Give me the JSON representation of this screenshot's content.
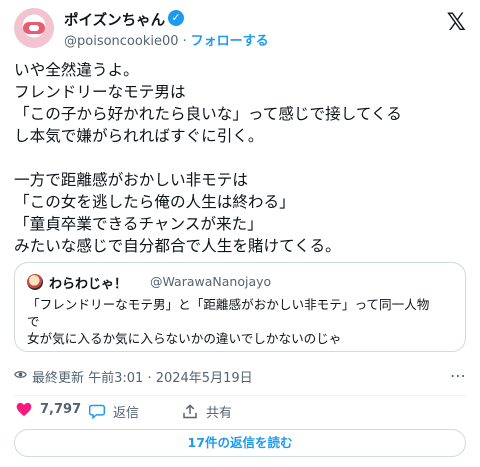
{
  "author": {
    "name": "ポイズンちゃん",
    "handle": "@poisoncookie00",
    "separator": "·",
    "follow_label": "フォローする",
    "verified_mark": "✓"
  },
  "x_logo": "𝕏",
  "post_lines": [
    "いや全然違うよ。",
    "フレンドリーなモテ男は",
    "「この子から好かれたら良いな」って感じで接してくる",
    "し本気で嫌がられればすぐに引く。",
    "",
    "一方で距離感がおかしい非モテは",
    "「この女を逃したら俺の人生は終わる」",
    "「童貞卒業できるチャンスが来た」",
    "みたいな感じで自分都合で人生を賭けてくる。"
  ],
  "quote": {
    "name": "わらわじゃ！",
    "handle": "@WarawaNanojayo",
    "lines": [
      "「フレンドリーなモテ男」と「距離感がおかしい非モテ」って同一人物",
      "で",
      "女が気に入るか気に入らないかの違いでしかないのじゃ"
    ]
  },
  "meta": {
    "text": "最終更新 午前3:01 · 2024年5月19日"
  },
  "actions": {
    "like_count": "7,797",
    "reply_label": "返信",
    "share_label": "共有"
  },
  "replies_button": "17件の返信を読む",
  "colors": {
    "accent": "#1d9bf0",
    "like": "#f91880",
    "text": "#0f1419",
    "secondary": "#536471"
  },
  "icons": [
    "verified-badge-icon",
    "x-logo-icon",
    "eye-icon",
    "more-icon",
    "heart-icon",
    "reply-icon",
    "share-icon"
  ]
}
